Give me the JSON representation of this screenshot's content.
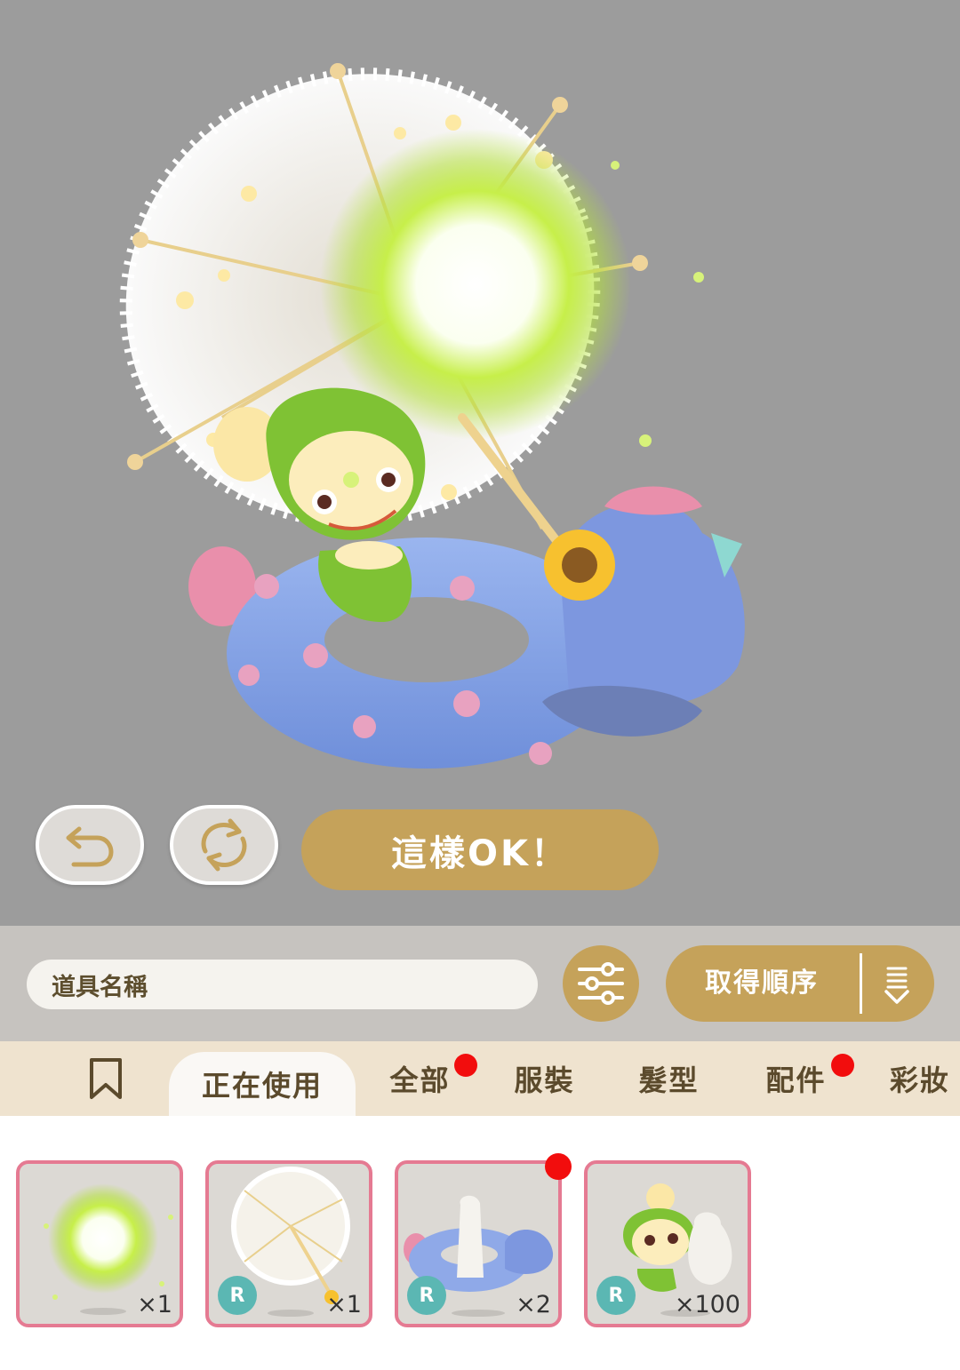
{
  "preview": {
    "confirm_label": "這樣OK！",
    "undo_icon": "undo-icon",
    "reroll_icon": "refresh-icon"
  },
  "toolbar": {
    "search_placeholder": "道具名稱",
    "filter_icon": "sliders-icon",
    "sort_label": "取得順序",
    "sort_direction_icon": "sort-descending-icon"
  },
  "tabs": [
    {
      "label": "",
      "icon": "bookmark-icon",
      "active": false,
      "badge": false
    },
    {
      "label": "正在使用",
      "active": true,
      "badge": false
    },
    {
      "label": "全部",
      "active": false,
      "badge": true
    },
    {
      "label": "服裝",
      "active": false,
      "badge": false
    },
    {
      "label": "髮型",
      "active": false,
      "badge": false
    },
    {
      "label": "配件",
      "active": false,
      "badge": true
    },
    {
      "label": "彩妝",
      "active": false,
      "badge": false
    }
  ],
  "items": [
    {
      "name": "glow-orb",
      "count": "×1",
      "rarity": "",
      "badge": false
    },
    {
      "name": "lace-parasol",
      "count": "×1",
      "rarity": "R",
      "badge": false
    },
    {
      "name": "unicorn-float",
      "count": "×2",
      "rarity": "R",
      "badge": true
    },
    {
      "name": "character-costume",
      "count": "×100",
      "rarity": "R",
      "badge": false
    }
  ],
  "colors": {
    "stage_bg": "#9c9c9c",
    "gold": "#c5a25a",
    "tab_bar": "#efe3cf",
    "item_border": "#e57a92",
    "badge": "#f20d0d",
    "rarity": "#5bb7b3"
  }
}
